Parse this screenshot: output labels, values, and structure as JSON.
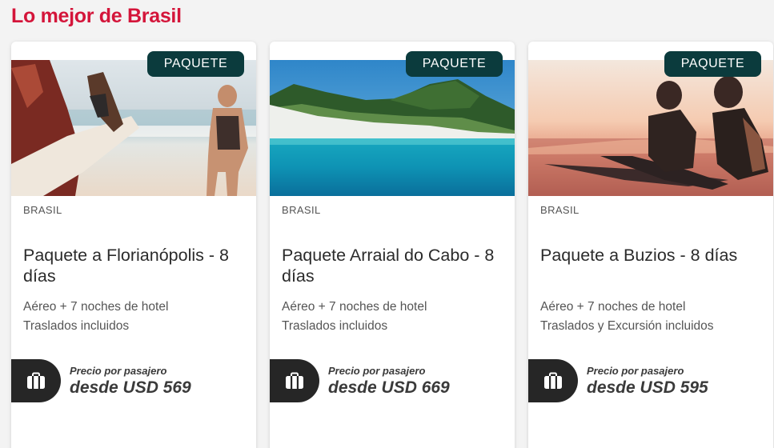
{
  "section": {
    "title": "Lo mejor de Brasil"
  },
  "cards": [
    {
      "badge": "PAQUETE",
      "country": "BRASIL",
      "title": "Paquete a Florianópolis - 8 días",
      "detail_1": "Aéreo + 7 noches de hotel",
      "detail_2": "Traslados incluidos",
      "price_label": "Precio por pasajero",
      "price": "desde USD 569",
      "image": "surfers-walking-beach"
    },
    {
      "badge": "PAQUETE",
      "country": "BRASIL",
      "title": "Paquete Arraial do Cabo - 8 días",
      "detail_1": "Aéreo + 7 noches de hotel",
      "detail_2": "Traslados incluidos",
      "price_label": "Precio por pasajero",
      "price": "desde USD 669",
      "image": "turquoise-beach-hills"
    },
    {
      "badge": "PAQUETE",
      "country": "BRASIL",
      "title": "Paquete a Buzios - 8 días",
      "detail_1": "Aéreo + 7 noches de hotel",
      "detail_2": "Traslados y Excursión incluidos",
      "price_label": "Precio por pasajero",
      "price": "desde USD 595",
      "image": "surfers-sunset"
    }
  ],
  "icons": {
    "package": "suitcase-icon"
  },
  "colors": {
    "title": "#d4153a",
    "badge": "#0b3b3d",
    "price_tab": "#262626"
  }
}
